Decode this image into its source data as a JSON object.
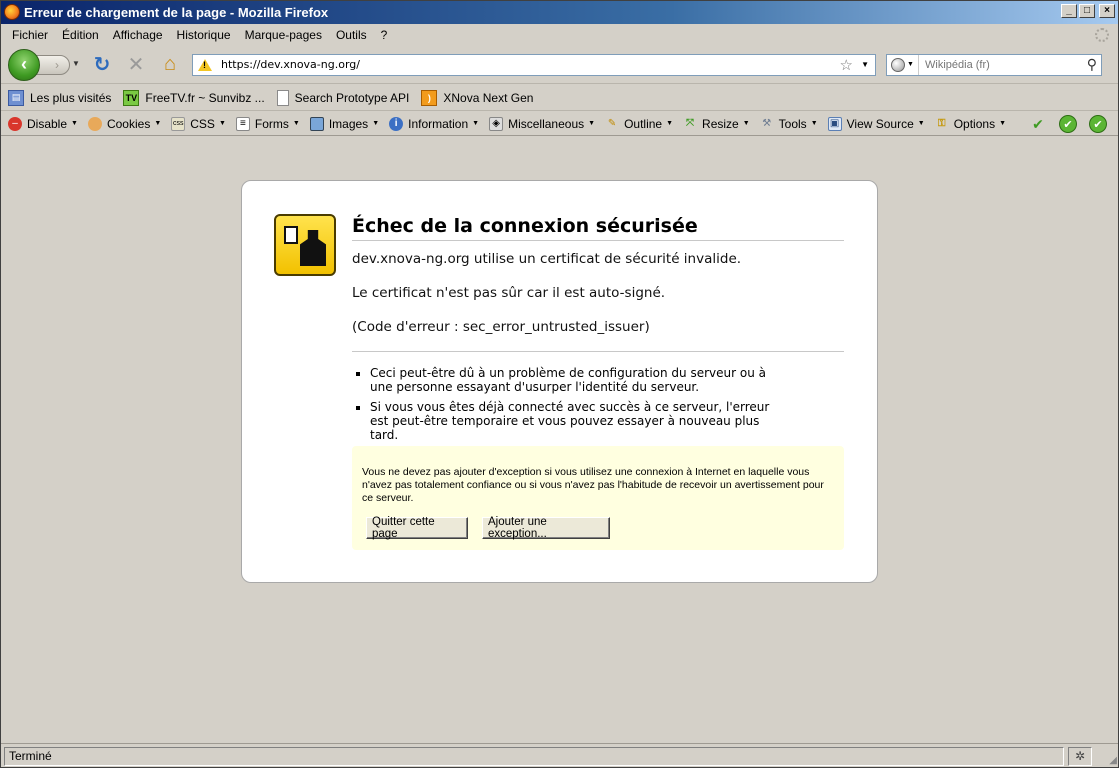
{
  "window": {
    "title": "Erreur de chargement de la page - Mozilla Firefox",
    "minimize": "_",
    "maximize": "□",
    "close": "×"
  },
  "menu": [
    {
      "label": "Fichier"
    },
    {
      "label": "Édition"
    },
    {
      "label": "Affichage"
    },
    {
      "label": "Historique"
    },
    {
      "label": "Marque-pages"
    },
    {
      "label": "Outils"
    },
    {
      "label": "?"
    }
  ],
  "nav": {
    "url": "https://dev.xnova-ng.org/",
    "search_placeholder": "Wikipédia (fr)"
  },
  "bookmarks": [
    {
      "label": "Les plus visités",
      "icon": "smart-folder-icon"
    },
    {
      "label": "FreeTV.fr ~ Sunvibz ...",
      "icon": "tv-icon"
    },
    {
      "label": "Search Prototype API",
      "icon": "page-icon"
    },
    {
      "label": "XNova Next Gen",
      "icon": "rss-icon"
    }
  ],
  "webdev": [
    {
      "label": "Disable",
      "icon": "disable-icon"
    },
    {
      "label": "Cookies",
      "icon": "cookies-icon"
    },
    {
      "label": "CSS",
      "icon": "css-icon"
    },
    {
      "label": "Forms",
      "icon": "forms-icon"
    },
    {
      "label": "Images",
      "icon": "images-icon"
    },
    {
      "label": "Information",
      "icon": "information-icon"
    },
    {
      "label": "Miscellaneous",
      "icon": "miscellaneous-icon"
    },
    {
      "label": "Outline",
      "icon": "outline-icon"
    },
    {
      "label": "Resize",
      "icon": "resize-icon"
    },
    {
      "label": "Tools",
      "icon": "tools-icon"
    },
    {
      "label": "View Source",
      "icon": "view-source-icon"
    },
    {
      "label": "Options",
      "icon": "options-icon"
    }
  ],
  "error": {
    "title": "Échec de la connexion sécurisée",
    "line1": "dev.xnova-ng.org utilise un certificat de sécurité invalide.",
    "line2": "Le certificat n'est pas sûr car il est auto-signé.",
    "line3": "(Code d'erreur : sec_error_untrusted_issuer)",
    "bullets": [
      "Ceci peut-être dû à un problème de configuration du serveur ou à une personne essayant d'usurper l'identité du serveur.",
      "Si vous vous êtes déjà connecté avec succès à ce serveur, l'erreur est peut-être temporaire et vous pouvez essayer à nouveau plus tard."
    ],
    "exception_text": "Vous ne devez pas ajouter d'exception si vous utilisez une connexion à Internet en laquelle vous n'avez pas totalement confiance ou si vous n'avez pas l'habitude de recevoir un avertissement pour ce serveur.",
    "quit_button": "Quitter cette page",
    "add_exception_button": "Ajouter une exception..."
  },
  "status": {
    "text": "Terminé"
  },
  "colors": {
    "chrome_bg": "#d4d0c8",
    "exception_bg": "#ffffe0",
    "titlebar_start": "#0a246a"
  }
}
